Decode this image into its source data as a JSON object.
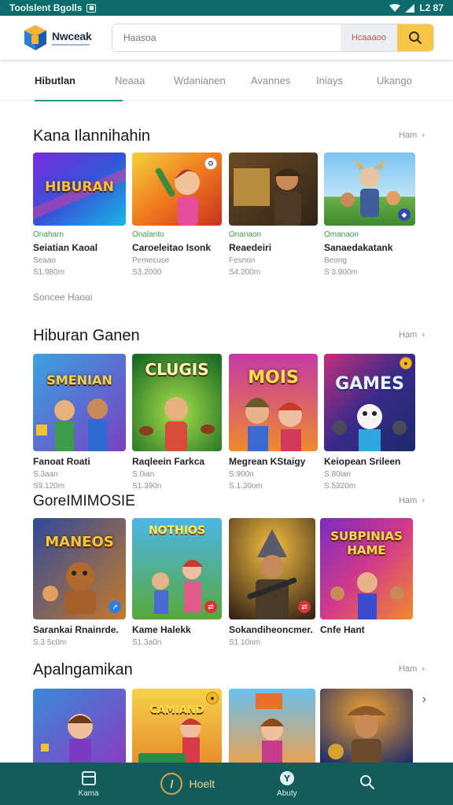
{
  "status_bar": {
    "left_text": "Toolslent Bgolls",
    "time": "L2 87"
  },
  "header": {
    "logo_name": "Nwceak",
    "search_placeholder": "Haasoa",
    "search_filter": "Hcaaaoo"
  },
  "tabs": [
    {
      "label": "Hibutlan",
      "active": true
    },
    {
      "label": "Neaaa",
      "active": false
    },
    {
      "label": "Wdanianen",
      "active": false
    },
    {
      "label": "Avannes",
      "active": false
    },
    {
      "label": "Iniays",
      "active": false
    },
    {
      "label": "Ukango",
      "active": false
    }
  ],
  "sections": [
    {
      "title": "Kana Ilannihahin",
      "more": "Ham",
      "footer_note": "Soncee  Haoai",
      "cards": [
        {
          "category": "Onaharn",
          "name": "Seiatian Kaoal",
          "line": "Seaao",
          "price": "S1.980m",
          "thumb_text": "HIBURAN"
        },
        {
          "category": "Onalanto",
          "name": "Caroeleitao  Isonk",
          "line": "Pemecuse",
          "price": "S3.2000",
          "thumb_text": ""
        },
        {
          "category": "Onanaon",
          "name": "Reaedeiri",
          "line": "Fesnon",
          "price": "S4.200m",
          "thumb_text": ""
        },
        {
          "category": "Omanaon",
          "name": "Sanaedakatank",
          "line": "Beong",
          "price": "S 3.900m",
          "thumb_text": ""
        }
      ]
    },
    {
      "title": "Hiburan Ganen",
      "more": "Ham",
      "cards": [
        {
          "name": "Fanoat  Roati",
          "line": "S.3aan",
          "price": "S9.120m",
          "thumb_text": "SMENIAN"
        },
        {
          "name": "Raqleein Farkca",
          "line": "S.0ian",
          "price": "S1.390n",
          "thumb_text": "CLUGIS"
        },
        {
          "name": "Megrean KStaigy",
          "line": "S.900n",
          "price": "S.1.30om",
          "thumb_text": "MOIS"
        },
        {
          "name": "Keiopean Srileen",
          "line": "S.80ian",
          "price": "S.5320m",
          "thumb_text": "GAMES"
        }
      ]
    },
    {
      "title": "GoreIMIMOSIE",
      "more": "Ham",
      "cards": [
        {
          "name": "Sarankai Rnainrde.",
          "line": "S.3 5c0m",
          "thumb_text": "MANEOS"
        },
        {
          "name": "Kame Halekk",
          "line": "S1.3a0n",
          "thumb_text": "NOTHIOS"
        },
        {
          "name": "Sokandiheoncmer.",
          "line": "S1 10nm",
          "thumb_text": ""
        },
        {
          "name": "Cnfe Hant",
          "line": "",
          "thumb_text": "SUBPINIAS HAME"
        }
      ]
    },
    {
      "title": "Apalngamikan",
      "more": "Ham",
      "cards": [
        {
          "thumb_text": ""
        },
        {
          "thumb_text": "CAMIAND"
        },
        {
          "thumb_text": ""
        },
        {
          "thumb_text": ""
        }
      ]
    }
  ],
  "bottom_nav": [
    {
      "label": "Kama",
      "icon": "tablet-icon"
    },
    {
      "label": "Hoelt",
      "icon": "logo-ring-icon"
    },
    {
      "label": "Abuty",
      "icon": "info-icon"
    },
    {
      "label": "",
      "icon": "search-icon"
    }
  ]
}
